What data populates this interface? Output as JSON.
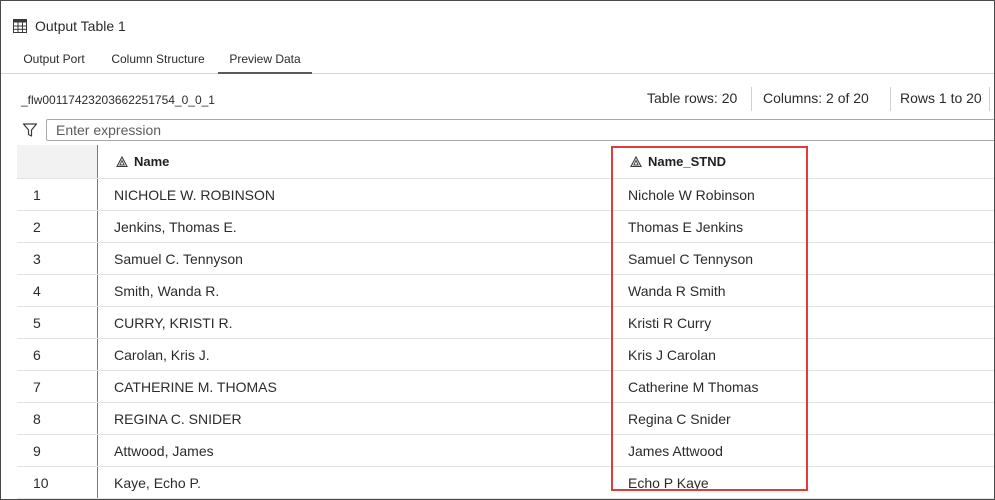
{
  "window": {
    "title": "Output Table 1",
    "icon": "table-icon"
  },
  "tabs": [
    {
      "label": "Output Port",
      "active": false
    },
    {
      "label": "Column Structure",
      "active": false
    },
    {
      "label": "Preview Data",
      "active": true
    }
  ],
  "info": {
    "table_name": "_flw00117423203662251754_0_0_1",
    "table_rows": "Table rows: 20",
    "columns": "Columns: 2 of 20",
    "rows_range": "Rows 1 to 20"
  },
  "filter": {
    "icon": "filter-icon",
    "placeholder": "Enter expression",
    "value": ""
  },
  "table": {
    "columns": [
      {
        "label": "Name",
        "type_icon": "character-type-icon"
      },
      {
        "label": "Name_STND",
        "type_icon": "character-type-icon"
      }
    ],
    "rows": [
      {
        "num": "1",
        "name": "NICHOLE W. ROBINSON",
        "name_stnd": "Nichole W Robinson"
      },
      {
        "num": "2",
        "name": "Jenkins, Thomas E.",
        "name_stnd": "Thomas E Jenkins"
      },
      {
        "num": "3",
        "name": "Samuel C. Tennyson",
        "name_stnd": "Samuel C Tennyson"
      },
      {
        "num": "4",
        "name": "Smith, Wanda R.",
        "name_stnd": "Wanda R Smith"
      },
      {
        "num": "5",
        "name": "CURRY, KRISTI R.",
        "name_stnd": "Kristi R Curry"
      },
      {
        "num": "6",
        "name": "Carolan, Kris J.",
        "name_stnd": "Kris J Carolan"
      },
      {
        "num": "7",
        "name": "CATHERINE M. THOMAS",
        "name_stnd": "Catherine M Thomas"
      },
      {
        "num": "8",
        "name": "REGINA C. SNIDER",
        "name_stnd": "Regina C Snider"
      },
      {
        "num": "9",
        "name": "Attwood, James",
        "name_stnd": "James Attwood"
      },
      {
        "num": "10",
        "name": "Kaye, Echo P.",
        "name_stnd": "Echo P Kaye"
      }
    ]
  },
  "highlight": {
    "color": "#e03c3c",
    "target": "Name_STND"
  }
}
